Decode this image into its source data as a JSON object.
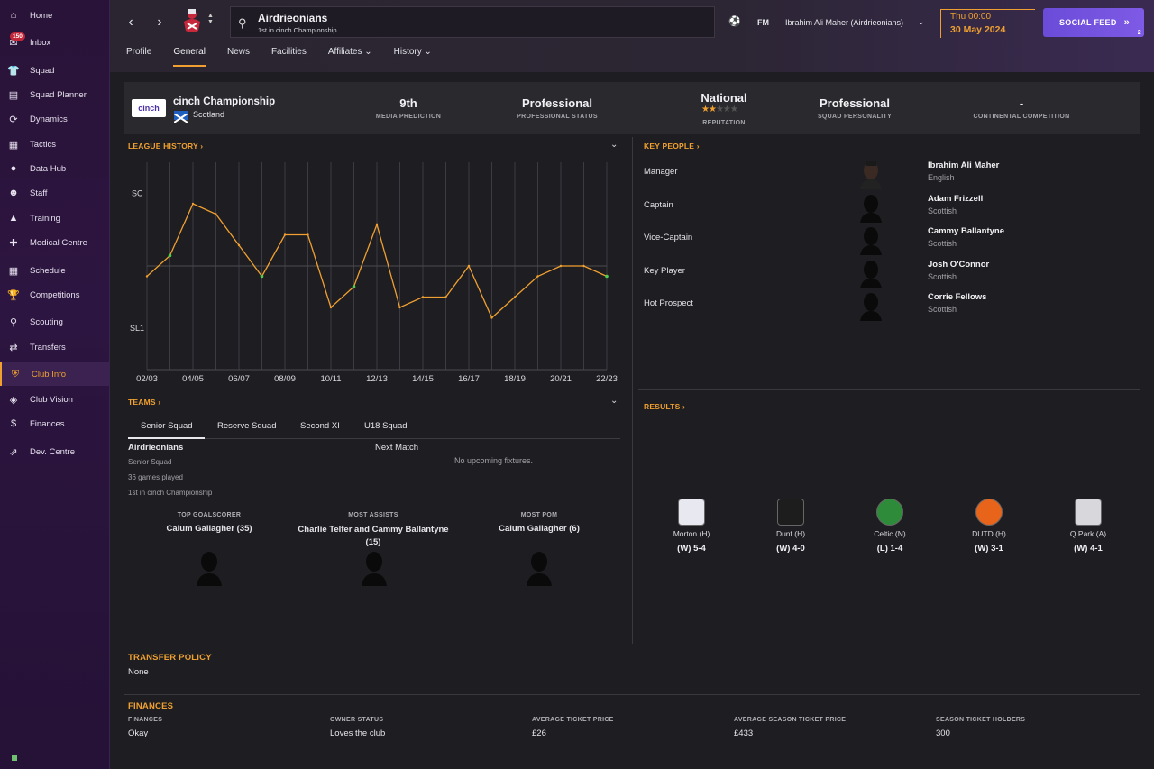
{
  "sidebar": {
    "items": [
      {
        "label": "Home",
        "icon": "home-icon"
      },
      {
        "label": "Inbox",
        "icon": "inbox-icon",
        "badge": "150"
      },
      {
        "label": "Squad",
        "icon": "shirt-icon"
      },
      {
        "label": "Squad Planner",
        "icon": "clipboard-icon"
      },
      {
        "label": "Dynamics",
        "icon": "dynamics-icon"
      },
      {
        "label": "Tactics",
        "icon": "tactics-icon"
      },
      {
        "label": "Data Hub",
        "icon": "data-hub-icon"
      },
      {
        "label": "Staff",
        "icon": "staff-icon"
      },
      {
        "label": "Training",
        "icon": "training-icon"
      },
      {
        "label": "Medical Centre",
        "icon": "medical-icon"
      },
      {
        "label": "Schedule",
        "icon": "calendar-icon"
      },
      {
        "label": "Competitions",
        "icon": "trophy-icon"
      },
      {
        "label": "Scouting",
        "icon": "scouting-icon"
      },
      {
        "label": "Transfers",
        "icon": "transfers-icon"
      },
      {
        "label": "Club Info",
        "icon": "club-info-icon",
        "active": true
      },
      {
        "label": "Club Vision",
        "icon": "vision-icon"
      },
      {
        "label": "Finances",
        "icon": "finances-icon"
      },
      {
        "label": "Dev. Centre",
        "icon": "dev-centre-icon"
      }
    ]
  },
  "header": {
    "club_name": "Airdrieonians",
    "club_sub": "1st in cinch Championship",
    "manager": "Ibrahim Ali Maher (Airdrieonians)",
    "fm_label": "FM",
    "day": "Thu 00:00",
    "date": "30 May 2024",
    "social_label": "SOCIAL FEED",
    "social_count": "2"
  },
  "tabs": [
    "Profile",
    "General",
    "News",
    "Facilities",
    "Affiliates",
    "History"
  ],
  "strip": {
    "league": "cinch Championship",
    "country": "Scotland",
    "media_prediction": "9th",
    "media_prediction_lbl": "MEDIA PREDICTION",
    "prof_status": "Professional",
    "prof_status_lbl": "PROFESSIONAL STATUS",
    "reputation": "National",
    "reputation_lbl": "REPUTATION",
    "reputation_stars": 2.5,
    "squad_personality": "Professional",
    "squad_personality_lbl": "SQUAD PERSONALITY",
    "continental": "-",
    "continental_lbl": "CONTINENTAL COMPETITION"
  },
  "league_history": {
    "title": "LEAGUE HISTORY",
    "y_labels": [
      "SC",
      "SL1"
    ],
    "x_labels": [
      "02/03",
      "04/05",
      "06/07",
      "08/09",
      "10/11",
      "12/13",
      "14/15",
      "16/17",
      "18/19",
      "20/21",
      "22/23"
    ]
  },
  "chart_data": {
    "type": "line",
    "categories": [
      "02/03",
      "03/04",
      "04/05",
      "05/06",
      "06/07",
      "07/08",
      "08/09",
      "09/10",
      "10/11",
      "11/12",
      "12/13",
      "13/14",
      "14/15",
      "15/16",
      "16/17",
      "17/18",
      "18/19",
      "19/20",
      "20/21",
      "21/22",
      "22/23"
    ],
    "series": [
      {
        "values": [
          11,
          9,
          4,
          5,
          8,
          11,
          7,
          7,
          14,
          12,
          6,
          14,
          13,
          13,
          10,
          15,
          13,
          11,
          10,
          10,
          11
        ]
      }
    ],
    "ylim": [
      0,
      20
    ]
  },
  "teams": {
    "title": "TEAMS",
    "tabs": [
      "Senior Squad",
      "Reserve Squad",
      "Second XI",
      "U18 Squad"
    ],
    "name": "Airdrieonians",
    "type": "Senior Squad",
    "games": "36 games played",
    "position": "1st in cinch Championship",
    "next_match_lbl": "Next Match",
    "no_fixtures": "No upcoming fixtures.",
    "top_scorer_lbl": "TOP GOALSCORER",
    "top_scorer": "Calum Gallagher (35)",
    "most_assists_lbl": "MOST ASSISTS",
    "most_assists": "Charlie Telfer and Cammy Ballantyne (15)",
    "most_pom_lbl": "MOST POM",
    "most_pom": "Calum Gallagher (6)"
  },
  "key_people": {
    "title": "KEY PEOPLE",
    "rows": [
      {
        "role": "Manager",
        "name": "Ibrahim Ali Maher",
        "nat": "English"
      },
      {
        "role": "Captain",
        "name": "Adam Frizzell",
        "nat": "Scottish"
      },
      {
        "role": "Vice-Captain",
        "name": "Cammy Ballantyne",
        "nat": "Scottish"
      },
      {
        "role": "Key Player",
        "name": "Josh O'Connor",
        "nat": "Scottish"
      },
      {
        "role": "Hot Prospect",
        "name": "Corrie Fellows",
        "nat": "Scottish"
      }
    ]
  },
  "results": {
    "title": "RESULTS",
    "items": [
      {
        "opp": "Morton (H)",
        "score": "(W) 5-4"
      },
      {
        "opp": "Dunf (H)",
        "score": "(W) 4-0"
      },
      {
        "opp": "Celtic (N)",
        "score": "(L) 1-4"
      },
      {
        "opp": "DUTD (H)",
        "score": "(W) 3-1"
      },
      {
        "opp": "Q Park (A)",
        "score": "(W) 4-1"
      }
    ]
  },
  "transfer_policy": {
    "title": "TRANSFER POLICY",
    "value": "None"
  },
  "finances": {
    "title": "FINANCES",
    "cols": [
      {
        "lbl": "FINANCES",
        "val": "Okay"
      },
      {
        "lbl": "OWNER STATUS",
        "val": "Loves the club"
      },
      {
        "lbl": "AVERAGE TICKET PRICE",
        "val": "£26"
      },
      {
        "lbl": "AVERAGE SEASON TICKET PRICE",
        "val": "£433"
      },
      {
        "lbl": "SEASON TICKET HOLDERS",
        "val": "300"
      }
    ]
  }
}
